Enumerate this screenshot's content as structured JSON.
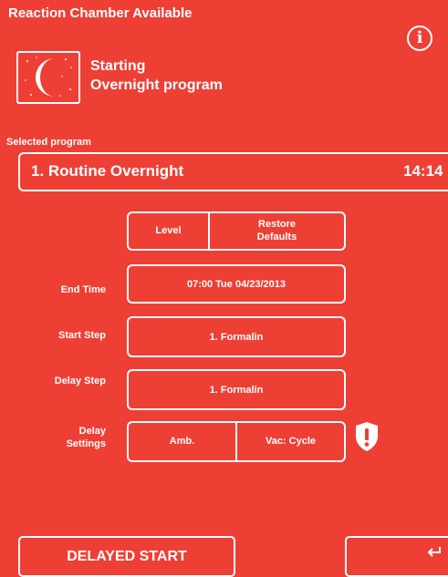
{
  "header": {
    "title": "Reaction Chamber Available",
    "info_icon_glyph": "i"
  },
  "status": {
    "icon": "moon-icon",
    "line1": "Starting",
    "line2": "Overnight program"
  },
  "program": {
    "label": "Selected program",
    "name": "1. Routine Overnight",
    "time": "14:14"
  },
  "options": {
    "level_label": "Level",
    "restore_label": "Restore Defaults"
  },
  "settings": {
    "end_time_label": "End Time",
    "end_time_value": "07:00  Tue 04/23/2013",
    "start_step_label": "Start Step",
    "start_step_value": "1. Formalin",
    "delay_step_label": "Delay Step",
    "delay_step_value": "1. Formalin",
    "delay_settings_label": "Delay Settings",
    "delay_amb": "Amb.",
    "delay_vac": "Vac: Cycle",
    "warning_icon": "shield-warning-icon"
  },
  "footer": {
    "delayed_start_label": "DELAYED START",
    "back_icon": "return-arrow-icon"
  },
  "colors": {
    "background": "#ee3f35",
    "foreground": "#ffffff"
  }
}
